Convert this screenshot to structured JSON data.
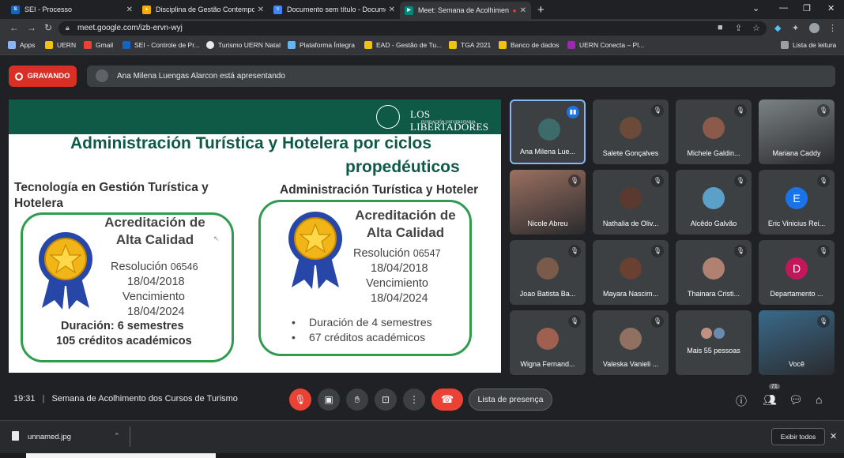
{
  "browser": {
    "tabs": [
      {
        "title": "SEI - Processo",
        "favicon": "sei-icon",
        "color": "#1565c0"
      },
      {
        "title": "Disciplina de Gestão Contempor",
        "favicon": "drive-icon",
        "color": "#f9ab00"
      },
      {
        "title": "Documento sem título - Docume",
        "favicon": "docs-icon",
        "color": "#4285f4"
      },
      {
        "title": "Meet: Semana de Acolhimen",
        "favicon": "meet-icon",
        "color": "#00897b"
      }
    ],
    "url": "meet.google.com/izb-ervn-wyj",
    "bookmarks": [
      {
        "label": "Apps",
        "icon": "apps-grid-icon"
      },
      {
        "label": "UERN",
        "icon": "folder-icon"
      },
      {
        "label": "Gmail",
        "icon": "gmail-icon"
      },
      {
        "label": "SEI - Controle de Pr...",
        "icon": "sei-icon"
      },
      {
        "label": "Turismo UERN Natal",
        "icon": "globe-icon"
      },
      {
        "label": "Plataforma Íntegra",
        "icon": "integra-icon"
      },
      {
        "label": "EAD - Gestão de Tu...",
        "icon": "folder-icon"
      },
      {
        "label": "TGA 2021",
        "icon": "folder-icon"
      },
      {
        "label": "Banco de dados",
        "icon": "folder-icon"
      },
      {
        "label": "UERN Conecta – Pl...",
        "icon": "uern-conecta-icon"
      }
    ],
    "reading_list": "Lista de leitura"
  },
  "meet": {
    "recording_label": "GRAVANDO",
    "presenting_text": "Ana Milena Luengas Alarcon está apresentando",
    "slide": {
      "logo": "LOS LIBERTADORES",
      "logo_sub": "FUNDACIÓN UNIVERSITARIA",
      "title_line1": "Administración Turística y Hotelera por ciclos",
      "title_line2": "propedéuticos",
      "left_heading": "Tecnología en Gestión Turística y Hotelera",
      "right_heading": "Administración Turística y Hoteler",
      "left_cert": {
        "title": "Acreditación de Alta Calidad",
        "resolution_label": "Resolución",
        "resolution_number": "06546",
        "date1": "18/04/2018",
        "expiry_label": "Vencimiento",
        "date2": "18/04/2024",
        "duration": "Duración: 6 semestres",
        "credits": "105 créditos académicos"
      },
      "right_cert": {
        "title": "Acreditación de Alta Calidad",
        "resolution_label": "Resolución",
        "resolution_number": "06547",
        "date1": "18/04/2018",
        "expiry_label": "Vencimiento",
        "date2": "18/04/2024",
        "bullet1": "Duración de 4 semestres",
        "bullet2": "67 créditos académicos"
      }
    },
    "participants": [
      {
        "name": "Ana Milena Lue...",
        "kind": "avatar",
        "color": "#3d6b6b"
      },
      {
        "name": "Salete Gonçalves",
        "kind": "avatar",
        "color": "#6b4a3a"
      },
      {
        "name": "Michele Galdin...",
        "kind": "avatar",
        "color": "#8b5a4a"
      },
      {
        "name": "Mariana Caddy",
        "kind": "photo",
        "color": "#7c8284"
      },
      {
        "name": "Nicole Abreu",
        "kind": "photo",
        "color": "#9b7060"
      },
      {
        "name": "Nathalia de Oliv...",
        "kind": "avatar",
        "color": "#5a3a2e"
      },
      {
        "name": "Alcêdo Galvão",
        "kind": "avatar",
        "color": "#5aa0c8"
      },
      {
        "name": "Eric Vinicius Rei...",
        "kind": "letter",
        "letter": "E",
        "color": "#1a73e8"
      },
      {
        "name": "Joao Batista Ba...",
        "kind": "avatar",
        "color": "#7a5a48"
      },
      {
        "name": "Mayara Nascim...",
        "kind": "avatar",
        "color": "#6a4030"
      },
      {
        "name": "Thainara Cristi...",
        "kind": "avatar",
        "color": "#b08070"
      },
      {
        "name": "Departamento ...",
        "kind": "letter",
        "letter": "D",
        "color": "#c2185b"
      },
      {
        "name": "Wigna Fernand...",
        "kind": "avatar",
        "color": "#a06050"
      },
      {
        "name": "Valeska Vanieli ...",
        "kind": "avatar",
        "color": "#907060"
      },
      {
        "name": "Mais 55 pessoas",
        "kind": "more",
        "color": "#3c4043"
      },
      {
        "name": "Você",
        "kind": "photo",
        "color": "#3a6a8a"
      }
    ],
    "clock": "19:31",
    "meeting_title": "Semana de Acolhimento dos Cursos de Turismo",
    "presence_button": "Lista de presença",
    "people_count": "71"
  },
  "downloads": {
    "file": "unnamed.jpg",
    "show_all": "Exibir todos"
  }
}
